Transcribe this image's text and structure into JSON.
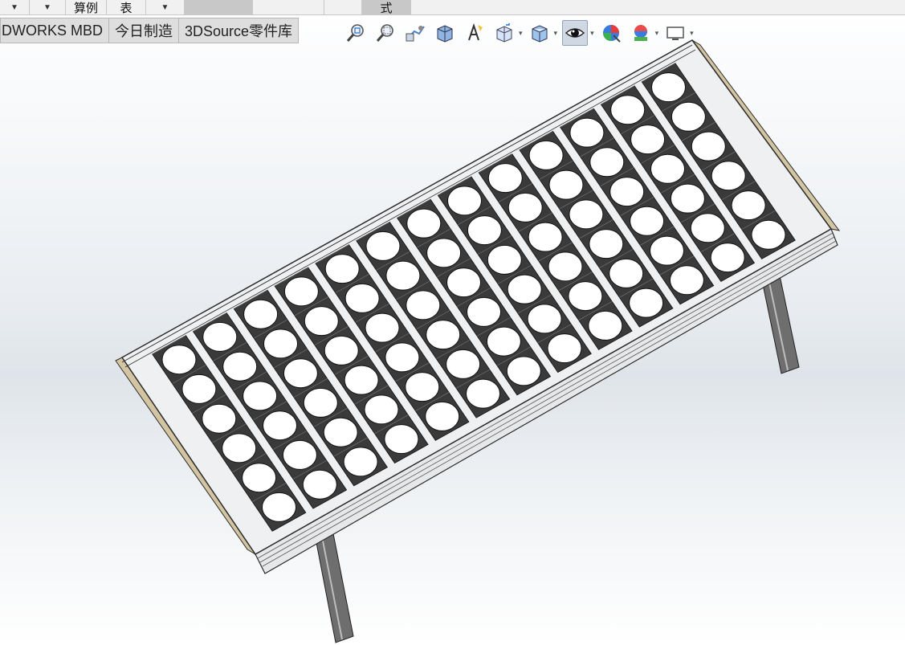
{
  "top_strip": {
    "dropdown_arrow": "▼",
    "label_1": "算例",
    "label_2": "表",
    "label_3": "式"
  },
  "tabs": [
    {
      "label": "DWORKS MBD"
    },
    {
      "label": "今日制造"
    },
    {
      "label": "3DSource零件库"
    }
  ],
  "view_toolbar": {
    "icons": [
      "zoom-to-fit-icon",
      "zoom-to-area-icon",
      "previous-view-icon",
      "section-view-icon",
      "dynamic-annotation-views-icon",
      "view-orientation-icon",
      "display-style-icon",
      "hide-show-items-icon",
      "edit-appearance-icon",
      "apply-scene-icon",
      "view-settings-icon"
    ],
    "dropdown_arrow": "▾"
  },
  "model": {
    "name": "solar-panel-rack",
    "columns": 13,
    "rows": 6,
    "colors": {
      "frame": "#eef0f2",
      "frame_edge": "#2b2b2b",
      "cell_pocket": "#3a3a3a",
      "cell_hole": "#ffffff",
      "end_cap": "#d3c5a2",
      "leg": "#6e6e6e"
    }
  }
}
